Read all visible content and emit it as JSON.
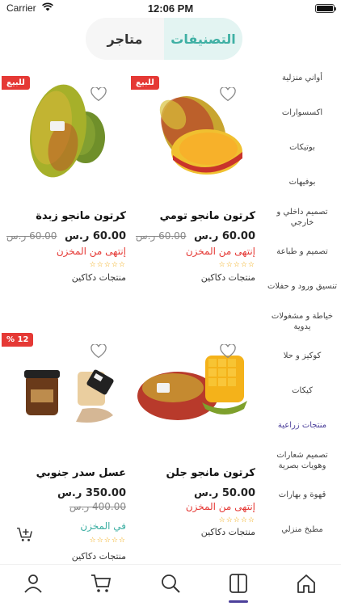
{
  "status": {
    "carrier": "Carrier",
    "time": "12:06 PM"
  },
  "tabs": {
    "stores": "متاجر",
    "categories": "التصنيفات"
  },
  "categories": [
    "أواني منزلية",
    "اكسسوارات",
    "بوتيكات",
    "بوفيهات",
    "تصميم داخلي و خارجي",
    "تصميم و طباعة",
    "تنسيق ورود و حفلات",
    "خياطة و مشغولات يدوية",
    "كوكيز و حلا",
    "كيكات",
    "منتجات زراعية",
    "تصميم شعارات وهويات بصرية",
    "قهوة و بهارات",
    "مطبخ منزلي"
  ],
  "active_category": "منتجات زراعية",
  "products": [
    {
      "name": "كرتون مانجو تومي",
      "price": "60.00 ر.س",
      "old_price": "60.00 ر.س",
      "stock": "إنتهى من المخزن",
      "stars": "☆☆☆☆☆",
      "vendor": "منتجات دكاكين",
      "badge": "للبيع"
    },
    {
      "name": "كرتون مانجو زبدة",
      "price": "60.00 ر.س",
      "old_price": "60.00 ر.س",
      "stock": "إنتهى من المخزن",
      "stars": "☆☆☆☆☆",
      "vendor": "منتجات دكاكين",
      "badge": "للبيع"
    },
    {
      "name": "كرتون مانجو جلن",
      "price": "50.00 ر.س",
      "old_price": "",
      "stock": "إنتهى من المخزن",
      "stars": "☆☆☆☆☆",
      "vendor": "منتجات دكاكين",
      "badge": ""
    },
    {
      "name": "عسل سدر جنوبي",
      "price": "350.00 ر.س",
      "old_price": "400.00 ر.س",
      "stock": "في المخزن",
      "stars": "☆☆☆☆☆",
      "vendor": "منتجات دكاكين",
      "badge": "12 %"
    }
  ],
  "colors": {
    "accent": "#3fb0a4",
    "primary": "#4b3f9a",
    "sale": "#e53935",
    "out_of_stock": "#e53935",
    "in_stock": "#3fb0a4"
  },
  "bottom_tabs": [
    "profile-icon",
    "cart-icon",
    "search-icon",
    "categories-icon",
    "home-icon"
  ],
  "active_bottom_tab": "categories-icon"
}
